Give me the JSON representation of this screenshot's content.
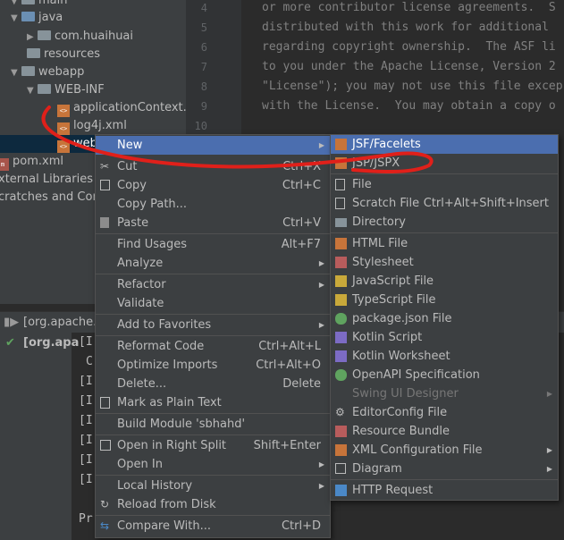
{
  "tree": {
    "items": [
      {
        "label": "main",
        "kind": "folder"
      },
      {
        "label": "java",
        "kind": "folder-blue"
      },
      {
        "label": "com.huaihuai",
        "kind": "package"
      },
      {
        "label": "resources",
        "kind": "folder"
      },
      {
        "label": "webapp",
        "kind": "folder"
      },
      {
        "label": "WEB-INF",
        "kind": "folder"
      },
      {
        "label": "applicationContext.xml",
        "kind": "xml"
      },
      {
        "label": "log4j.xml",
        "kind": "xml"
      },
      {
        "label": "web",
        "kind": "xml"
      },
      {
        "label": "pom.xml",
        "kind": "maven"
      },
      {
        "label": "xternal Libraries",
        "kind": "library"
      },
      {
        "label": "cratches and Cons",
        "kind": "scratch"
      }
    ]
  },
  "editor": {
    "line_numbers": [
      "4",
      "5",
      "6",
      "7",
      "8",
      "9",
      "10"
    ],
    "lines": [
      "or more contributor license agreements.  S",
      "distributed with this work for additional",
      "regarding copyright ownership.  The ASF li",
      "to you under the Apache License, Version 2",
      "\"License\"); you may not use this file excep",
      "with the License.  You may obtain a copy o",
      ""
    ]
  },
  "run": {
    "tab_label": "[org.apache.m",
    "tree_label": "[org.apa",
    "console_lines": [
      "[I",
      "C",
      "[I",
      "[I",
      "[I",
      "[I",
      "[I",
      "[I",
      "",
      "Pr"
    ]
  },
  "context_menu": {
    "items": [
      {
        "label": "New",
        "submenu": true,
        "highlighted": true
      },
      {
        "label": "Cut",
        "shortcut": "Ctrl+X",
        "icon": "scissors-icon"
      },
      {
        "label": "Copy",
        "shortcut": "Ctrl+C",
        "icon": "copy-icon"
      },
      {
        "label": "Copy Path...",
        "shortcut": ""
      },
      {
        "label": "Paste",
        "shortcut": "Ctrl+V",
        "icon": "paste-icon"
      },
      {
        "label": "Find Usages",
        "shortcut": "Alt+F7"
      },
      {
        "label": "Analyze",
        "submenu": true
      },
      {
        "label": "Refactor",
        "submenu": true
      },
      {
        "label": "Validate"
      },
      {
        "label": "Add to Favorites",
        "submenu": true
      },
      {
        "label": "Reformat Code",
        "shortcut": "Ctrl+Alt+L"
      },
      {
        "label": "Optimize Imports",
        "shortcut": "Ctrl+Alt+O"
      },
      {
        "label": "Delete...",
        "shortcut": "Delete"
      },
      {
        "label": "Mark as Plain Text",
        "icon": "plain-text-icon"
      },
      {
        "label": "Build Module 'sbhahd'"
      },
      {
        "label": "Open in Right Split",
        "shortcut": "Shift+Enter",
        "icon": "split-icon"
      },
      {
        "label": "Open In",
        "submenu": true
      },
      {
        "label": "Local History",
        "submenu": true
      },
      {
        "label": "Reload from Disk",
        "icon": "reload-icon"
      },
      {
        "label": "Compare With...",
        "shortcut": "Ctrl+D",
        "icon": "compare-icon"
      }
    ]
  },
  "new_submenu": {
    "items": [
      {
        "label": "JSF/Facelets",
        "highlighted": true,
        "icon": "jsp-icon"
      },
      {
        "label": "JSP/JSPX",
        "icon": "jsp-icon"
      },
      {
        "label": "File",
        "icon": "file-icon"
      },
      {
        "label": "Scratch File",
        "shortcut": "Ctrl+Alt+Shift+Insert",
        "icon": "scratch-file-icon"
      },
      {
        "label": "Directory",
        "icon": "directory-icon"
      },
      {
        "label": "HTML File",
        "icon": "html-icon"
      },
      {
        "label": "Stylesheet",
        "icon": "css-icon"
      },
      {
        "label": "JavaScript File",
        "icon": "js-icon"
      },
      {
        "label": "TypeScript File",
        "icon": "ts-icon"
      },
      {
        "label": "package.json File",
        "icon": "package-json-icon"
      },
      {
        "label": "Kotlin Script",
        "icon": "kotlin-icon"
      },
      {
        "label": "Kotlin Worksheet",
        "icon": "kotlin-icon"
      },
      {
        "label": "OpenAPI Specification",
        "icon": "openapi-icon"
      },
      {
        "label": "Swing UI Designer",
        "disabled": true,
        "submenu": true
      },
      {
        "label": "EditorConfig File",
        "icon": "editorconfig-icon"
      },
      {
        "label": "Resource Bundle",
        "icon": "resource-bundle-icon"
      },
      {
        "label": "XML Configuration File",
        "submenu": true,
        "icon": "xml-icon"
      },
      {
        "label": "Diagram",
        "submenu": true,
        "icon": "diagram-icon"
      },
      {
        "label": "HTTP Request",
        "icon": "api-icon"
      }
    ]
  },
  "colors": {
    "highlight": "#4b6eaf",
    "menu_bg": "#3c3f41",
    "annotation": "#e0201a"
  }
}
